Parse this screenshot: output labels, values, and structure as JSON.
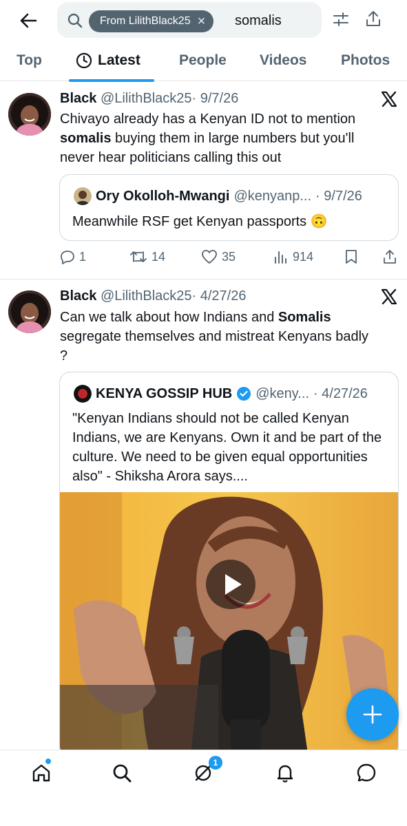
{
  "search": {
    "chip_label": "From LilithBlack25",
    "query": "somalis"
  },
  "tabs": [
    {
      "label": "Top"
    },
    {
      "label": "Latest"
    },
    {
      "label": "People"
    },
    {
      "label": "Videos"
    },
    {
      "label": "Photos"
    }
  ],
  "tweets": [
    {
      "name": "Black",
      "handle": "@LilithBlack25",
      "date": "· 9/7/26",
      "text_a": "Chivayo already has a Kenyan ID not to mention ",
      "text_b": "somalis",
      "text_c": " buying them in large numbers but you'll never hear politicians calling this out",
      "quote": {
        "name": "Ory Okolloh-Mwangi",
        "handle": "@kenyanp...",
        "date": "· 9/7/26",
        "text": "Meanwhile RSF get Kenyan passports 🙃"
      },
      "replies": "1",
      "reposts": "14",
      "likes": "35",
      "views": "914"
    },
    {
      "name": "Black",
      "handle": "@LilithBlack25",
      "date": "· 4/27/26",
      "text_a": "Can we talk about how Indians and ",
      "text_b": "Somalis",
      "text_c": " segregate themselves and mistreat Kenyans badly ?",
      "quote": {
        "name": "KENYA GOSSIP HUB",
        "handle": "@keny...",
        "date": "· 4/27/26",
        "text": "\"Kenyan Indians should not be called Kenyan Indians, we are Kenyans. Own it and be part of the culture. We need to be given equal opportunities also\" - Shiksha Arora says...."
      }
    }
  ],
  "nav": {
    "messages_badge": "1"
  },
  "colors": {
    "accent": "#1d9bf0",
    "text": "#0f1419",
    "secondary": "#536471"
  }
}
